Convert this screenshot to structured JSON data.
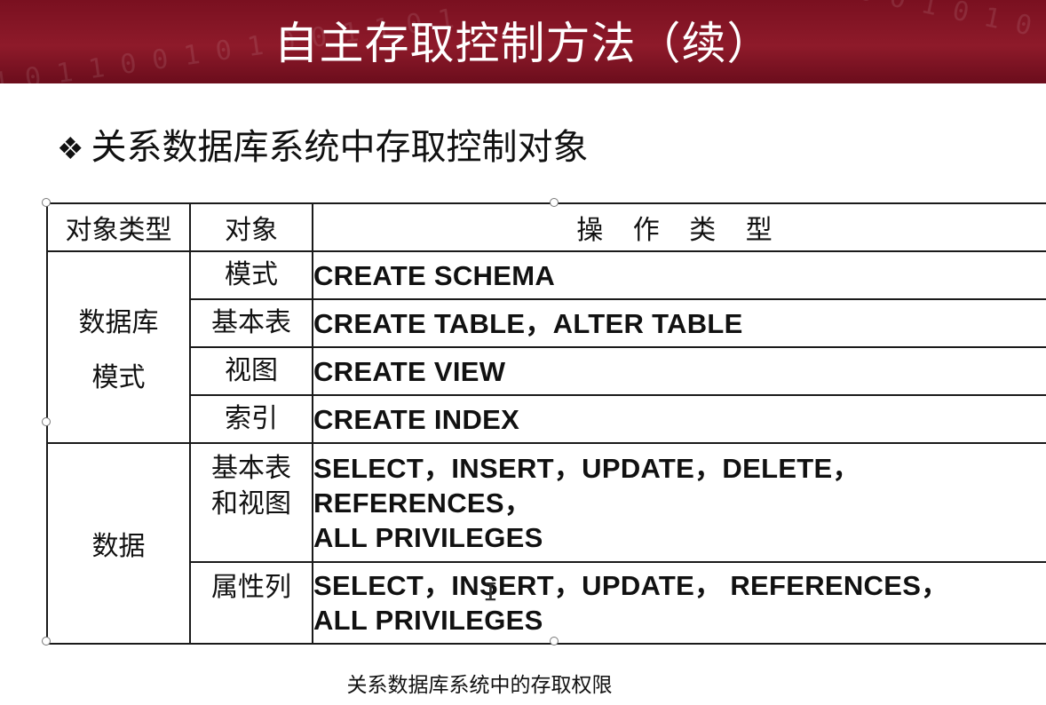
{
  "title": "自主存取控制方法（续）",
  "title_pattern": "1 0 1 1 0 0 1 0 1 0 0 1 1 0 1",
  "bullet": {
    "mark": "❖",
    "text": "关系数据库系统中存取控制对象"
  },
  "table": {
    "headers": [
      "对象类型",
      "对象",
      "操 作 类 型"
    ],
    "groups": [
      {
        "type_lines": [
          "数据库",
          "模式"
        ],
        "rows": [
          {
            "object_lines": [
              "模式"
            ],
            "ops_lines": [
              "CREATE SCHEMA"
            ]
          },
          {
            "object_lines": [
              "基本表"
            ],
            "ops_lines": [
              "CREATE TABLE，ALTER TABLE"
            ]
          },
          {
            "object_lines": [
              "视图"
            ],
            "ops_lines": [
              "CREATE VIEW"
            ]
          },
          {
            "object_lines": [
              "索引"
            ],
            "ops_lines": [
              "CREATE INDEX"
            ]
          }
        ]
      },
      {
        "type_lines": [
          "数据"
        ],
        "rows": [
          {
            "object_lines": [
              "基本表",
              "和视图"
            ],
            "ops_lines": [
              "SELECT，INSERT，UPDATE，DELETE，",
              "REFERENCES，",
              "ALL PRIVILEGES"
            ]
          },
          {
            "object_lines": [
              "属性列"
            ],
            "ops_lines": [
              "SELECT，INSERT，UPDATE， REFERENCES，",
              "ALL PRIVILEGES"
            ]
          }
        ]
      }
    ]
  },
  "caption": "关系数据库系统中的存取权限",
  "colors": {
    "title_bg": "#7a1020",
    "title_text": "#ffffff",
    "border": "#1a1a1a"
  }
}
